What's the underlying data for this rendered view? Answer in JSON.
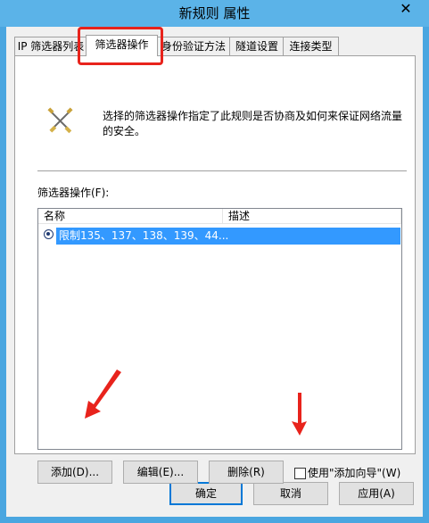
{
  "window": {
    "title": "新规则 属性",
    "close_glyph": "✕"
  },
  "tabs": [
    {
      "label": "IP 筛选器列表"
    },
    {
      "label": "筛选器操作"
    },
    {
      "label": "身份验证方法"
    },
    {
      "label": "隧道设置"
    },
    {
      "label": "连接类型"
    }
  ],
  "panel": {
    "icon": "tools-icon",
    "description": "选择的筛选器操作指定了此规则是否协商及如何来保证网络流量的安全。",
    "list_label": "筛选器操作(F):",
    "columns": [
      "名称",
      "描述"
    ],
    "rows": [
      {
        "name": "限制135、137、138、139、44...",
        "description": "",
        "selected": true
      }
    ]
  },
  "actions": {
    "add": "添加(D)...",
    "edit": "编辑(E)...",
    "remove": "删除(R)",
    "wizard": "使用\"添加向导\"(W)",
    "wizard_checked": false
  },
  "footer": {
    "ok": "确定",
    "cancel": "取消",
    "apply": "应用(A)"
  },
  "colors": {
    "title_bar": "#5bb3e8",
    "selection": "#3399ff",
    "annotation_red": "#e8231c"
  }
}
